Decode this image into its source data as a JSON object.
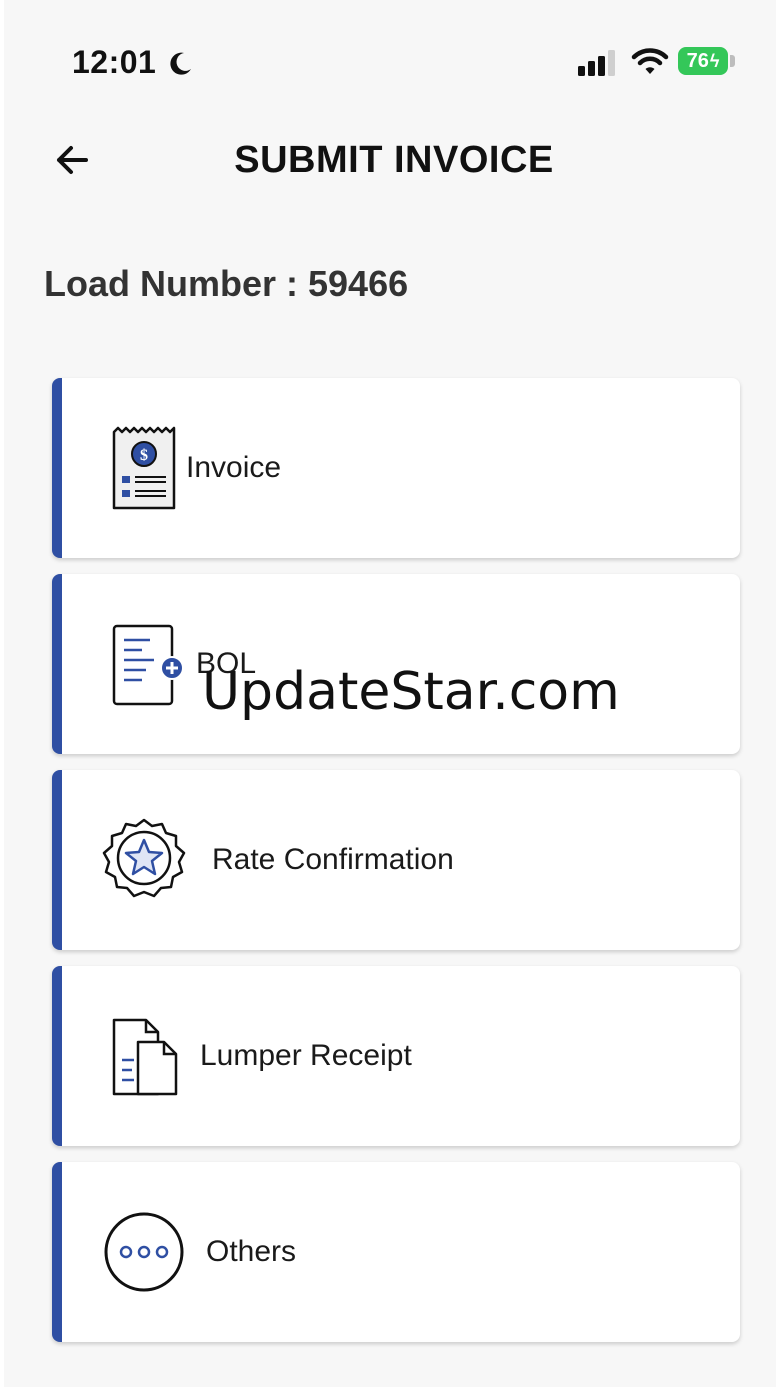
{
  "status_bar": {
    "time": "12:01",
    "battery_level": "76"
  },
  "header": {
    "title": "SUBMIT INVOICE"
  },
  "load": {
    "label": "Load Number : 59466"
  },
  "documents": [
    {
      "label": "Invoice",
      "icon": "invoice-receipt-icon"
    },
    {
      "label": "BOL",
      "icon": "bol-document-add-icon"
    },
    {
      "label": "Rate Confirmation",
      "icon": "star-badge-icon"
    },
    {
      "label": "Lumper Receipt",
      "icon": "files-icon"
    },
    {
      "label": "Others",
      "icon": "more-dots-icon"
    }
  ],
  "watermark": "UpdateStar.com",
  "colors": {
    "accent": "#2f4fa3",
    "battery": "#34c759",
    "background": "#f7f7f7"
  }
}
